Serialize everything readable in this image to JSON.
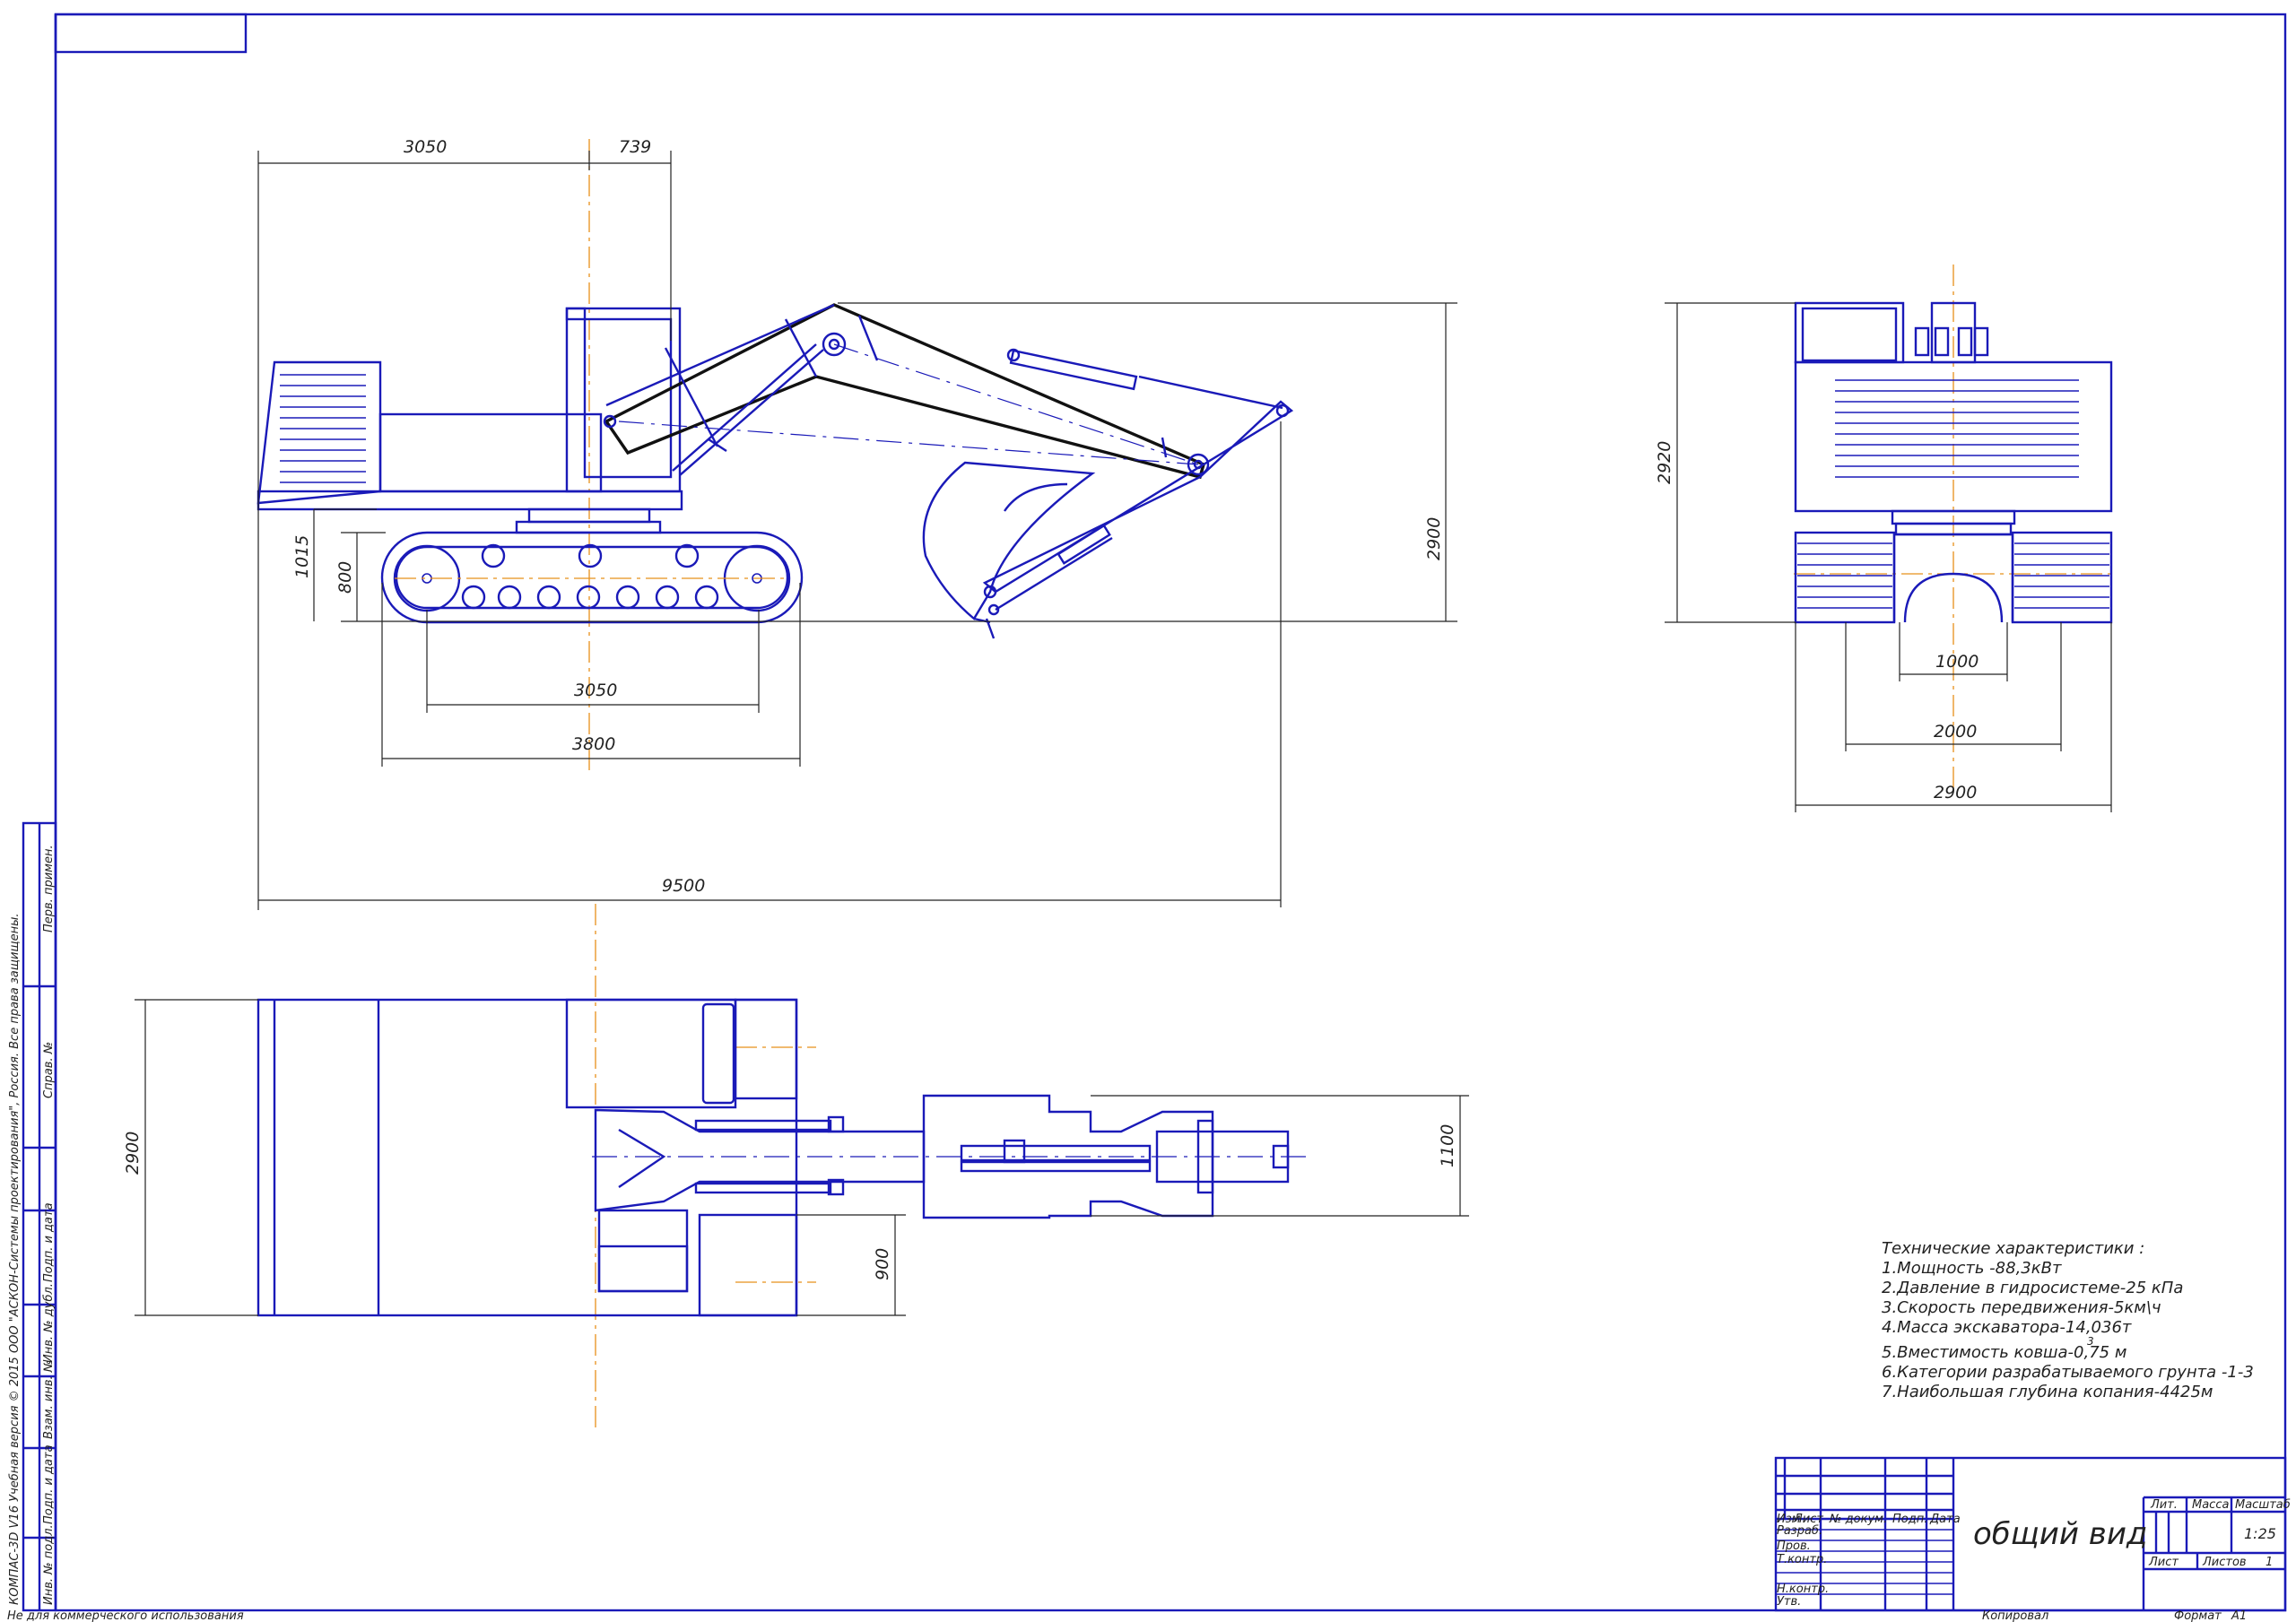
{
  "side_view": {
    "dims": {
      "top_left": "3050",
      "top_right": "739",
      "height_total": "2900",
      "track_height": "1015",
      "track_inner": "800",
      "track_base": "3050",
      "track_length": "3800",
      "overall_length": "9500"
    }
  },
  "front_view": {
    "dims": {
      "height": "2920",
      "gap": "1000",
      "track_gauge": "2000",
      "width": "2900"
    }
  },
  "top_view": {
    "dims": {
      "width": "2900",
      "arm_width": "1100",
      "offset": "900"
    }
  },
  "specs": {
    "title": "Технические характеристики :",
    "items": [
      "1.Мощность -88,3кВт",
      "2.Давление в гидросистеме-25 кПа",
      "3.Скорость передвижения-5км\\ч",
      "4.Масса экскаватора-14,036т",
      "5.Вместимость ковша-0,75 м",
      "6.Категории разрабатываемого грунта -1-3",
      "7.Наибольшая глубина копания-4425м"
    ],
    "superscript": "3"
  },
  "title_block": {
    "drawing_title": "общий вид",
    "col_izm": "Изм",
    "col_list": "Лист",
    "col_doc": "№ докум.",
    "col_sign": "Подп.",
    "col_date": "Дата",
    "row_razrab": "Разраб.",
    "row_prov": "Пров.",
    "row_tkontr": "Т.контр.",
    "row_nkontr": "Н.контр.",
    "row_utv": "Утв.",
    "lit": "Лит.",
    "massa": "Масса",
    "masshtab": "Масштаб",
    "scale": "1:25",
    "list": "Лист",
    "listov": "Листов",
    "listov_val": "1",
    "copied": "Копировал",
    "format_label": "Формат",
    "format_value": "A1"
  },
  "side_strip": {
    "perv_primen": "Перв. примен.",
    "sprav": "Справ. №",
    "podp_data_1": "Подп. и дата",
    "inv_dubl": "Инв. № дубл.",
    "vzam_inv": "Взам. инв. №",
    "podp_data_2": "Подп. и дата",
    "inv_podl": "Инв. № подл.",
    "kompas_note": "КОМПАС-3D V16 Учебная версия © 2015 ООО \"АСКОН-Системы проектирования\", Россия. Все права защищены.",
    "noncommercial": "Не для коммерческого использования"
  }
}
